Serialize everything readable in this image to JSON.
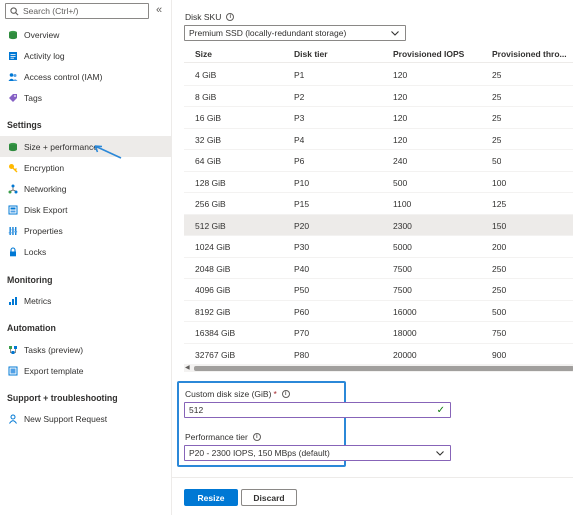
{
  "sidebar": {
    "search_placeholder": "Search (Ctrl+/)",
    "collapse_glyph": "«",
    "top_items": [
      {
        "label": "Overview",
        "icon": "overview-icon"
      },
      {
        "label": "Activity log",
        "icon": "activity-log-icon"
      },
      {
        "label": "Access control (IAM)",
        "icon": "iam-icon"
      },
      {
        "label": "Tags",
        "icon": "tag-icon"
      }
    ],
    "sections": {
      "settings": "Settings",
      "monitoring": "Monitoring",
      "automation": "Automation",
      "support": "Support + troubleshooting"
    },
    "settings_items": [
      {
        "label": "Size + performance",
        "icon": "disk-icon",
        "selected": true
      },
      {
        "label": "Encryption",
        "icon": "key-icon"
      },
      {
        "label": "Networking",
        "icon": "networking-icon"
      },
      {
        "label": "Disk Export",
        "icon": "export-icon"
      },
      {
        "label": "Properties",
        "icon": "properties-icon"
      },
      {
        "label": "Locks",
        "icon": "lock-icon"
      }
    ],
    "monitoring_items": [
      {
        "label": "Metrics",
        "icon": "metrics-icon"
      }
    ],
    "automation_items": [
      {
        "label": "Tasks (preview)",
        "icon": "tasks-icon"
      },
      {
        "label": "Export template",
        "icon": "template-icon"
      }
    ],
    "support_items": [
      {
        "label": "New Support Request",
        "icon": "support-icon"
      }
    ]
  },
  "main": {
    "disk_sku_label": "Disk SKU",
    "disk_sku_value": "Premium SSD (locally-redundant storage)",
    "table": {
      "headers": [
        "Size",
        "Disk tier",
        "Provisioned IOPS",
        "Provisioned thro..."
      ],
      "rows": [
        [
          "4 GiB",
          "P1",
          "120",
          "25"
        ],
        [
          "8 GiB",
          "P2",
          "120",
          "25"
        ],
        [
          "16 GiB",
          "P3",
          "120",
          "25"
        ],
        [
          "32 GiB",
          "P4",
          "120",
          "25"
        ],
        [
          "64 GiB",
          "P6",
          "240",
          "50"
        ],
        [
          "128 GiB",
          "P10",
          "500",
          "100"
        ],
        [
          "256 GiB",
          "P15",
          "1100",
          "125"
        ],
        [
          "512 GiB",
          "P20",
          "2300",
          "150"
        ],
        [
          "1024 GiB",
          "P30",
          "5000",
          "200"
        ],
        [
          "2048 GiB",
          "P40",
          "7500",
          "250"
        ],
        [
          "4096 GiB",
          "P50",
          "7500",
          "250"
        ],
        [
          "8192 GiB",
          "P60",
          "16000",
          "500"
        ],
        [
          "16384 GiB",
          "P70",
          "18000",
          "750"
        ],
        [
          "32767 GiB",
          "P80",
          "20000",
          "900"
        ]
      ],
      "selected_row": 7
    },
    "custom_size_label": "Custom disk size (GiB)",
    "required_mark": "*",
    "custom_size_value": "512",
    "perf_tier_label": "Performance tier",
    "perf_tier_value": "P20 - 2300 IOPS, 150 MBps (default)",
    "resize_label": "Resize",
    "discard_label": "Discard"
  },
  "colors": {
    "accent": "#0078d4",
    "highlight_box": "#2b88d8",
    "selected_bg": "#edebe9"
  }
}
